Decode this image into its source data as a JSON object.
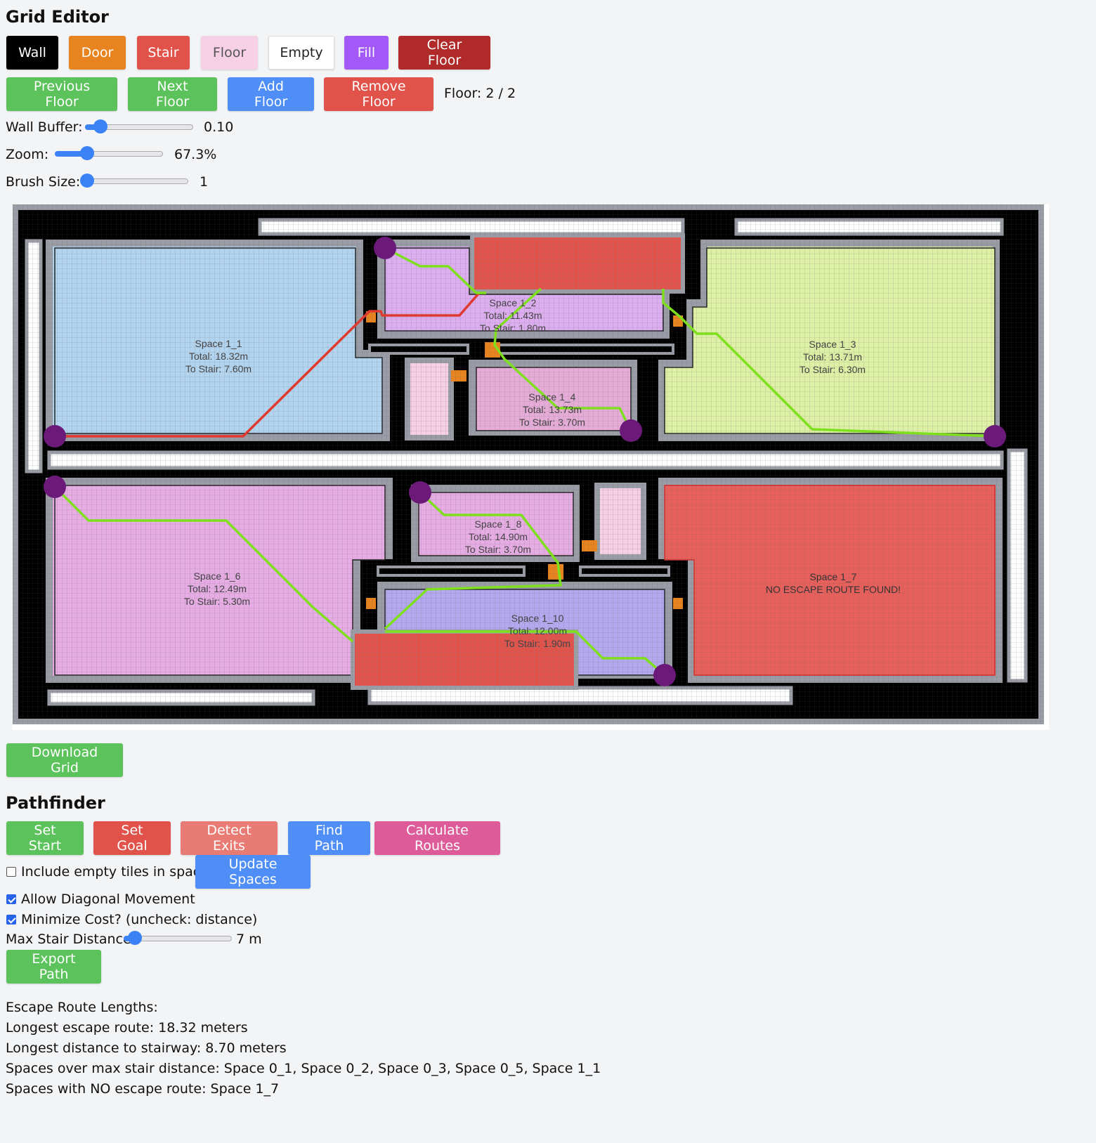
{
  "grid_editor": {
    "title": "Grid Editor",
    "tools": [
      {
        "label": "Wall",
        "color": "#000000",
        "text_color": "#ffffff"
      },
      {
        "label": "Door",
        "color": "#e8841f",
        "text_color": "#ffffff"
      },
      {
        "label": "Stair",
        "color": "#e0524a",
        "text_color": "#ffffff"
      },
      {
        "label": "Floor",
        "color": "#f6d0e4",
        "text_color": "#555555"
      },
      {
        "label": "Empty",
        "color": "#ffffff",
        "text_color": "#222222"
      },
      {
        "label": "Fill",
        "color": "#a259f7",
        "text_color": "#ffffff"
      },
      {
        "label": "Clear Floor",
        "color": "#b02a2a",
        "text_color": "#ffffff"
      }
    ],
    "floor_controls": [
      {
        "label": "Previous Floor",
        "color": "#5cc35c"
      },
      {
        "label": "Next Floor",
        "color": "#5cc35c"
      },
      {
        "label": "Add Floor",
        "color": "#4f8ef7"
      },
      {
        "label": "Remove Floor",
        "color": "#e0524a"
      }
    ],
    "floor_indicator": "Floor: 2 / 2",
    "wall_buffer": {
      "label": "Wall Buffer:",
      "value_text": "0.10",
      "fraction": 0.15
    },
    "zoom": {
      "label": "Zoom:",
      "value_text": "67.3%",
      "fraction": 0.3
    },
    "brush_size": {
      "label": "Brush Size:",
      "value_text": "1",
      "fraction": 0.0
    }
  },
  "floor_plan": {
    "spaces": [
      {
        "name": "Space 1_1",
        "lines": [
          "Space 1_1",
          "Total: 18.32m",
          "To Stair: 7.60m"
        ],
        "color": "#b3d4ef"
      },
      {
        "name": "Space 1_2",
        "lines": [
          "Space 1_2",
          "Total: 11.43m",
          "To Stair: 1.80m"
        ],
        "color": "#dcaef0"
      },
      {
        "name": "Space 1_3",
        "lines": [
          "Space 1_3",
          "Total: 13.71m",
          "To Stair: 6.30m"
        ],
        "color": "#def0a6"
      },
      {
        "name": "Space 1_4",
        "lines": [
          "Space 1_4",
          "Total: 13.73m",
          "To Stair: 3.70m"
        ],
        "color": "#e6acd8"
      },
      {
        "name": "Space 1_6",
        "lines": [
          "Space 1_6",
          "Total: 12.49m",
          "To Stair: 5.30m"
        ],
        "color": "#e6ace4"
      },
      {
        "name": "Space 1_8",
        "lines": [
          "Space 1_8",
          "Total: 14.90m",
          "To Stair: 3.70m"
        ],
        "color": "#e6ace4"
      },
      {
        "name": "Space 1_7",
        "lines": [
          "Space 1_7",
          "NO ESCAPE ROUTE FOUND!"
        ],
        "color": "#e8605c"
      },
      {
        "name": "Space 1_10",
        "lines": [
          "Space 1_10",
          "Total: 12.00m",
          "To Stair: 1.90m"
        ],
        "color": "#b4a8ee"
      }
    ]
  },
  "download_label": "Download Grid",
  "pathfinder": {
    "title": "Pathfinder",
    "buttons": [
      {
        "label": "Set Start",
        "color": "#5cc35c"
      },
      {
        "label": "Set Goal",
        "color": "#e0524a"
      },
      {
        "label": "Detect Exits",
        "color": "#e87b74"
      },
      {
        "label": "Find Path",
        "color": "#4f8ef7"
      },
      {
        "label": "Calculate Routes",
        "color": "#de5b9a"
      }
    ],
    "update_spaces": "Update Spaces",
    "include_empty": {
      "label": "Include empty tiles in spaces",
      "checked": false
    },
    "allow_diagonal": {
      "label": "Allow Diagonal Movement",
      "checked": true
    },
    "minimize_cost": {
      "label": "Minimize Cost? (uncheck: distance)",
      "checked": true
    },
    "max_stair": {
      "label": "Max Stair Distance:",
      "value_text": "7 m",
      "fraction": 0.1
    },
    "export_label": "Export Path"
  },
  "results": {
    "heading": "Escape Route Lengths:",
    "longest_route": "Longest escape route: 18.32 meters",
    "longest_stair": "Longest distance to stairway: 8.70 meters",
    "over_max": "Spaces over max stair distance: Space 0_1, Space 0_2, Space 0_3, Space 0_5, Space 1_1",
    "no_route": "Spaces with NO escape route: Space 1_7"
  }
}
